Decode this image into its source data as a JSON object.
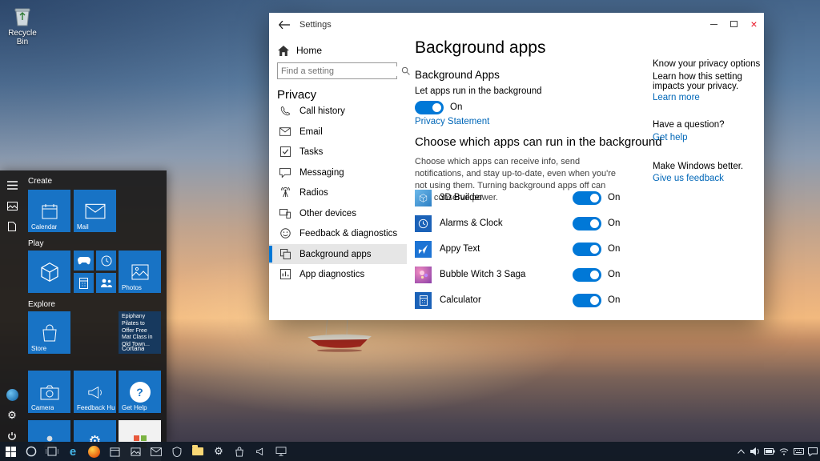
{
  "glyphs": {
    "close": "×",
    "edge": "e",
    "gear": "⚙",
    "question": "?"
  },
  "desktop": {
    "recycle_bin_label": "Recycle Bin"
  },
  "start_menu": {
    "groups": {
      "create": "Create",
      "play": "Play",
      "explore": "Explore"
    },
    "tiles": {
      "calendar": "Calendar",
      "mail": "Mail",
      "photos": "Photos",
      "store": "Store",
      "news_headline": "Epiphany Pilates to Offer Free Mat Class in Old Town...",
      "cortana": "Cortana",
      "camera": "Camera",
      "feedback_hub": "Feedback Hub",
      "get_help": "Get Help"
    }
  },
  "settings_window": {
    "title": "Settings",
    "nav": {
      "home": "Home",
      "search_placeholder": "Find a setting",
      "section": "Privacy",
      "items": [
        {
          "label": "Call history"
        },
        {
          "label": "Email"
        },
        {
          "label": "Tasks"
        },
        {
          "label": "Messaging"
        },
        {
          "label": "Radios"
        },
        {
          "label": "Other devices"
        },
        {
          "label": "Feedback & diagnostics"
        },
        {
          "label": "Background apps"
        },
        {
          "label": "App diagnostics"
        }
      ]
    },
    "main": {
      "page_title": "Background apps",
      "group_title": "Background Apps",
      "master_toggle_label": "Let apps run in the background",
      "master_toggle_state": "On",
      "privacy_statement_link": "Privacy Statement",
      "section_heading": "Choose which apps can run in the background",
      "section_description": "Choose which apps can receive info, send notifications, and stay up-to-date, even when you're not using them. Turning background apps off can help conserve power.",
      "apps": [
        {
          "name": "3D Builder",
          "state": "On"
        },
        {
          "name": "Alarms & Clock",
          "state": "On"
        },
        {
          "name": "Appy Text",
          "state": "On"
        },
        {
          "name": "Bubble Witch 3 Saga",
          "state": "On"
        },
        {
          "name": "Calculator",
          "state": "On"
        }
      ]
    },
    "aside": {
      "privacy_options_title": "Know your privacy options",
      "privacy_options_desc": "Learn how this setting impacts your privacy.",
      "learn_more_link": "Learn more",
      "question_title": "Have a question?",
      "get_help_link": "Get help",
      "improve_title": "Make Windows better.",
      "give_feedback_link": "Give us feedback"
    }
  },
  "colors": {
    "accent": "#0078d7"
  }
}
